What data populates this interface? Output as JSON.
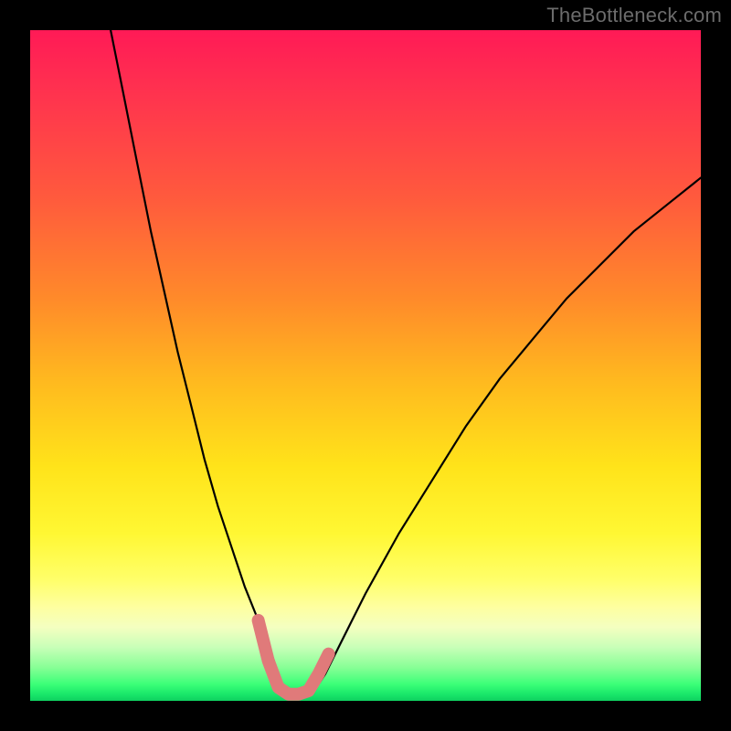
{
  "watermark": "TheBottleneck.com",
  "chart_data": {
    "type": "line",
    "title": "",
    "xlabel": "",
    "ylabel": "",
    "xlim": [
      0,
      100
    ],
    "ylim": [
      0,
      100
    ],
    "series": [
      {
        "name": "curve",
        "x": [
          12,
          14,
          16,
          18,
          20,
          22,
          24,
          26,
          28,
          30,
          32,
          34,
          36,
          37,
          38,
          42,
          44,
          46,
          48,
          50,
          55,
          60,
          65,
          70,
          75,
          80,
          85,
          90,
          95,
          100
        ],
        "y": [
          100,
          90,
          80,
          70,
          61,
          52,
          44,
          36,
          29,
          23,
          17,
          12,
          7,
          4,
          1,
          1,
          4,
          8,
          12,
          16,
          25,
          33,
          41,
          48,
          54,
          60,
          65,
          70,
          74,
          78
        ]
      }
    ],
    "highlight_segment": {
      "color": "#e07a7a",
      "x": [
        34,
        35.5,
        37,
        38.5,
        40,
        41.5,
        43,
        44.5
      ],
      "y": [
        12,
        6,
        2,
        1,
        1,
        1.5,
        4,
        7
      ]
    },
    "gradient_stops": [
      {
        "pos": 0,
        "color": "#ff1a56"
      },
      {
        "pos": 0.25,
        "color": "#ff5a3d"
      },
      {
        "pos": 0.5,
        "color": "#ffb81f"
      },
      {
        "pos": 0.75,
        "color": "#fff733"
      },
      {
        "pos": 0.9,
        "color": "#f4ffc0"
      },
      {
        "pos": 1.0,
        "color": "#0fd060"
      }
    ]
  }
}
